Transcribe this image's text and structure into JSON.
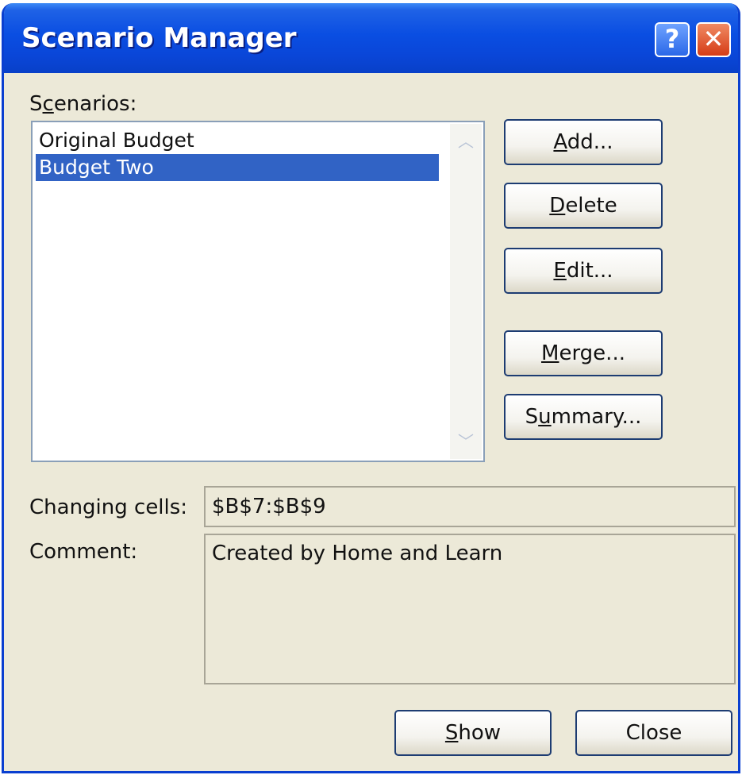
{
  "window": {
    "title": "Scenario Manager",
    "help_label": "?",
    "close_label": "✕"
  },
  "scenarios": {
    "label_pre": "S",
    "label_mnemonic": "c",
    "label_post": "enarios:",
    "items": [
      "Original Budget",
      "Budget Two"
    ],
    "selected_index": 1
  },
  "buttons": {
    "add": {
      "mnemonic": "A",
      "rest": "dd..."
    },
    "delete": {
      "mnemonic": "D",
      "rest": "elete"
    },
    "edit": {
      "mnemonic": "E",
      "rest": "dit..."
    },
    "merge": {
      "mnemonic": "M",
      "rest": "erge..."
    },
    "summary": {
      "pre": "S",
      "mnemonic": "u",
      "rest": "mmary..."
    },
    "show": {
      "mnemonic": "S",
      "rest": "how"
    },
    "close": "Close"
  },
  "details": {
    "changing_cells_label": "Changing cells:",
    "changing_cells_value": "$B$7:$B$9",
    "comment_label": "Comment:",
    "comment_value": "Created by Home and Learn"
  },
  "icons": {
    "scroll_up": "chevron-up-icon",
    "scroll_down": "chevron-down-icon"
  },
  "colors": {
    "titlebar": "#0a4ee2",
    "selection": "#3163c5",
    "dialog_bg": "#ece9d8"
  }
}
